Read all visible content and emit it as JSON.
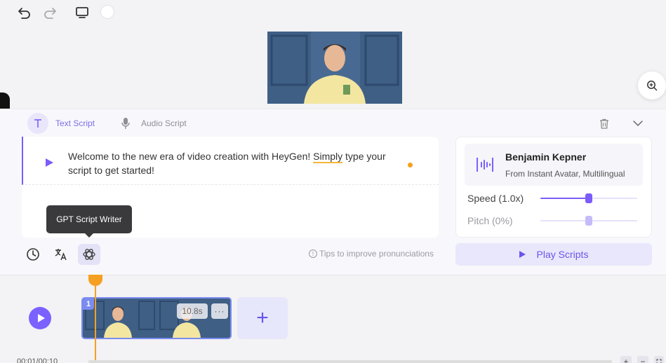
{
  "toolbar": {
    "undo_icon": "undo-icon",
    "redo_icon": "redo-icon",
    "monitor_icon": "monitor-icon"
  },
  "editor": {
    "tabs": [
      {
        "label": "Text Script",
        "icon": "text-t-icon",
        "active": true
      },
      {
        "label": "Audio Script",
        "icon": "microphone-icon",
        "active": false
      }
    ],
    "script": {
      "text_before": "Welcome to the new era of video creation with HeyGen! ",
      "text_highlight": "Simply",
      "text_after": " type your script to get started!"
    },
    "tooltip": "GPT Script Writer",
    "tips": "Tips to improve pronunciations"
  },
  "voice": {
    "name": "Benjamin Kepner",
    "subtitle": "From Instant Avatar, Multilingual",
    "speed_label": "Speed (1.0x)",
    "speed_value": 0.5,
    "pitch_label": "Pitch (0%)",
    "pitch_value": 0.5
  },
  "play_scripts_label": "Play Scripts",
  "timeline": {
    "clip_index": "1",
    "clip_duration": "10.8s",
    "clip_more": "···",
    "add_label": "+",
    "time": "00:01/00:10"
  },
  "colors": {
    "accent": "#7c5cfa",
    "playhead": "#f5a021"
  }
}
